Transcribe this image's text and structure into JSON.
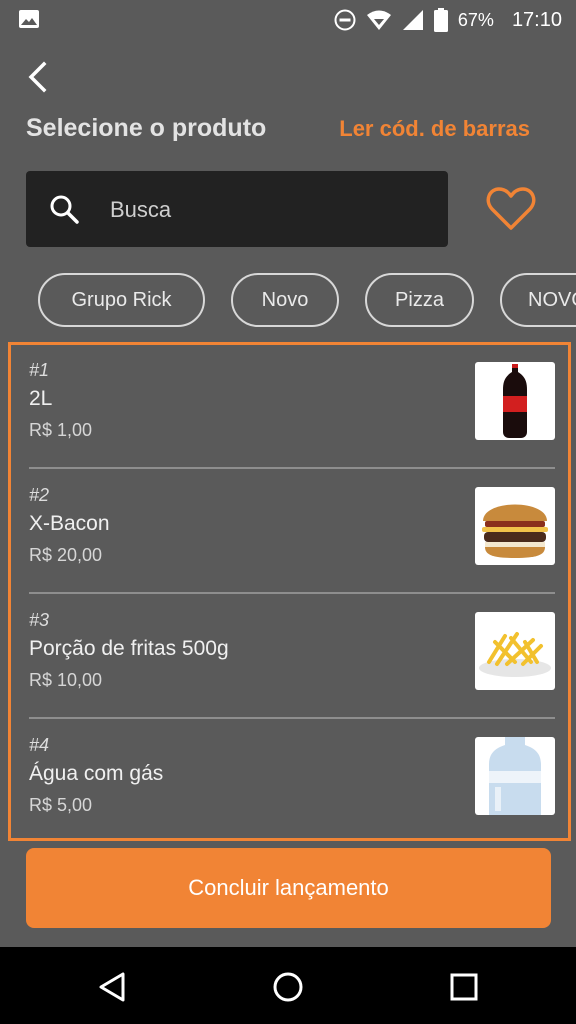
{
  "status_bar": {
    "battery": "67%",
    "time": "17:10"
  },
  "header": {
    "title": "Selecione o produto",
    "barcode_link": "Ler cód. de barras"
  },
  "search": {
    "placeholder": "Busca"
  },
  "chips": [
    "Grupo Rick",
    "Novo",
    "Pizza",
    "NOVO"
  ],
  "products": [
    {
      "number": "#1",
      "name": "2L",
      "price": "R$ 1,00",
      "image": "soda-bottle"
    },
    {
      "number": "#2",
      "name": "X-Bacon",
      "price": "R$ 20,00",
      "image": "burger"
    },
    {
      "number": "#3",
      "name": "Porção de fritas 500g",
      "price": "R$ 10,00",
      "image": "fries"
    },
    {
      "number": "#4",
      "name": "Água com gás",
      "price": "R$ 5,00",
      "image": "water-bottle"
    }
  ],
  "footer": {
    "button_label": "Concluir lançamento"
  },
  "colors": {
    "accent": "#f18435",
    "background": "#5a5a5a",
    "search_bg": "#222222"
  }
}
